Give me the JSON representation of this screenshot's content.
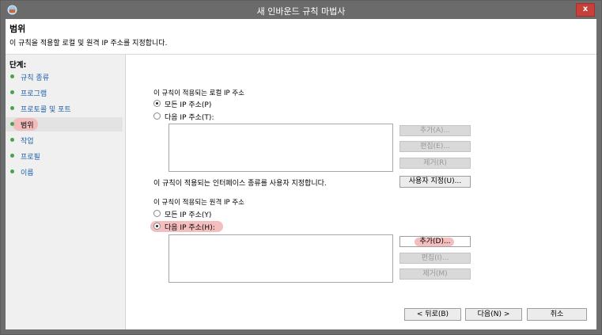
{
  "window": {
    "title": "새 인바운드 규칙 마법사",
    "close_glyph": "x"
  },
  "header": {
    "title": "범위",
    "description": "이 규칙을 적용할 로컬 및 원격 IP 주소를 지정합니다."
  },
  "sidebar": {
    "steps_label": "단계:",
    "steps": [
      {
        "label": "규칙 종류"
      },
      {
        "label": "프로그램"
      },
      {
        "label": "프로토콜 및 포트"
      },
      {
        "label": "범위"
      },
      {
        "label": "작업"
      },
      {
        "label": "프로필"
      },
      {
        "label": "이름"
      }
    ]
  },
  "local": {
    "section_label": "이 규칙이 적용되는 로컬 IP 주소",
    "radio_any": "모든 IP 주소(P)",
    "radio_these": "다음 IP 주소(T):",
    "add": "추가(A)...",
    "edit": "편집(E)...",
    "remove": "제거(R)"
  },
  "interface": {
    "text": "이 규칙이 적용되는 인터페이스 종류를 사용자 지정합니다.",
    "customize": "사용자 지정(U)..."
  },
  "remote": {
    "section_label": "이 규칙이 적용되는 원격 IP 주소",
    "radio_any": "모든 IP 주소(Y)",
    "radio_these": "다음 IP 주소(H):",
    "add": "추가(D)...",
    "edit": "편집(I)...",
    "remove": "제거(M)"
  },
  "footer": {
    "back": "< 뒤로(B)",
    "next": "다음(N) >",
    "cancel": "취소"
  },
  "colors": {
    "step_link": "#1e5fa8",
    "step_dot": "#4aa24a",
    "highlight": "#f4b7b7",
    "close": "#c7413a"
  }
}
